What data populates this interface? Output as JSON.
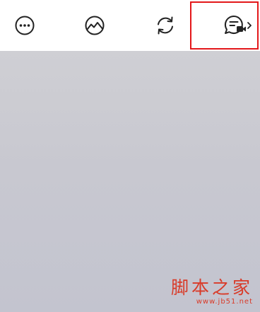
{
  "toolbar": {
    "icons": {
      "more": "more-options-icon",
      "image": "image-gallery-icon",
      "rotate": "rotate-camera-icon",
      "call": "message-video-switch-icon"
    },
    "highlight_color": "#e3171a"
  },
  "preview": {
    "colors": {
      "top": "#cfcfd4",
      "bottom": "#c3c4cf"
    }
  },
  "watermark": {
    "brand": "脚本之家",
    "url": "www.jb51.net",
    "color": "#d93a28"
  }
}
